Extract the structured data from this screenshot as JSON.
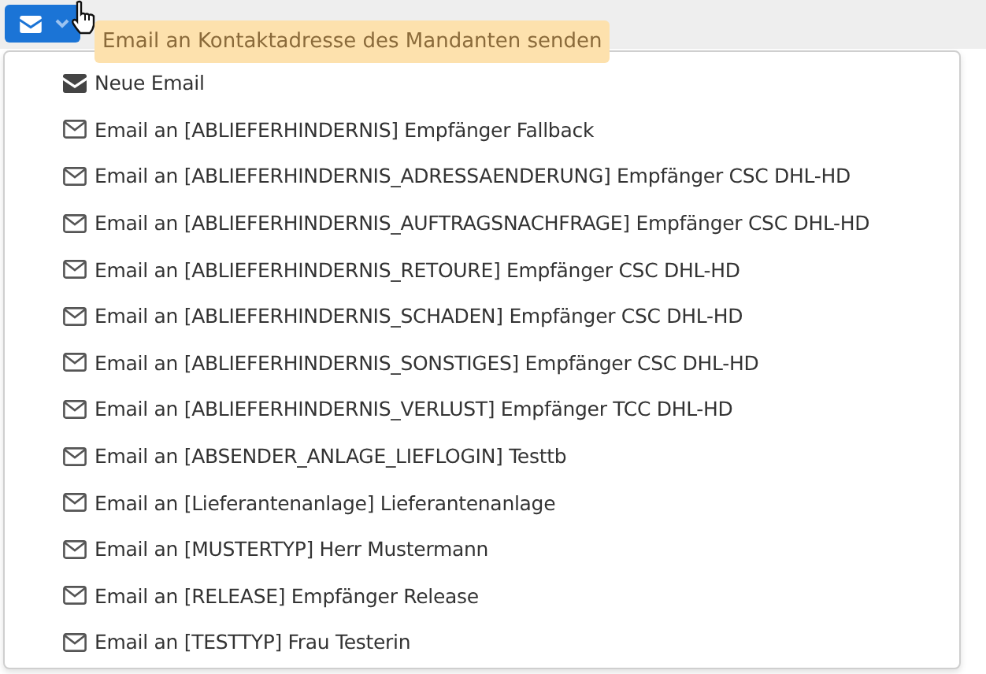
{
  "tooltip": {
    "text": "Email an Kontaktadresse des Mandanten senden"
  },
  "menu": {
    "items": [
      {
        "kind": "new",
        "label": "Neue Email"
      },
      {
        "kind": "email",
        "label": "Email an [ABLIEFERHINDERNIS] Empfänger Fallback"
      },
      {
        "kind": "email",
        "label": "Email an [ABLIEFERHINDERNIS_ADRESSAENDERUNG] Empfänger CSC DHL-HD"
      },
      {
        "kind": "email",
        "label": "Email an [ABLIEFERHINDERNIS_AUFTRAGSNACHFRAGE] Empfänger CSC DHL-HD"
      },
      {
        "kind": "email",
        "label": "Email an [ABLIEFERHINDERNIS_RETOURE] Empfänger CSC DHL-HD"
      },
      {
        "kind": "email",
        "label": "Email an [ABLIEFERHINDERNIS_SCHADEN] Empfänger CSC DHL-HD"
      },
      {
        "kind": "email",
        "label": "Email an [ABLIEFERHINDERNIS_SONSTIGES] Empfänger CSC DHL-HD"
      },
      {
        "kind": "email",
        "label": "Email an [ABLIEFERHINDERNIS_VERLUST] Empfänger TCC DHL-HD"
      },
      {
        "kind": "email",
        "label": "Email an [ABSENDER_ANLAGE_LIEFLOGIN] Testtb"
      },
      {
        "kind": "email",
        "label": "Email an [Lieferantenanlage] Lieferantenanlage"
      },
      {
        "kind": "email",
        "label": "Email an [MUSTERTYP] Herr Mustermann"
      },
      {
        "kind": "email",
        "label": "Email an [RELEASE] Empfänger Release"
      },
      {
        "kind": "email",
        "label": "Email an [TESTTYP] Frau Testerin"
      }
    ]
  }
}
